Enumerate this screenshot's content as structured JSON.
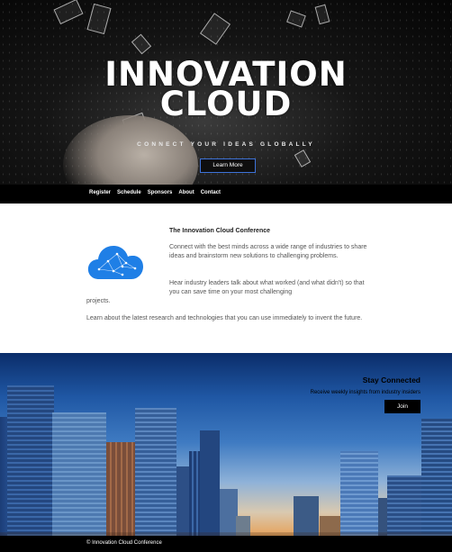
{
  "hero": {
    "title_line1": "INNOVATION",
    "title_line2": "CLOUD",
    "tagline": "CONNECT YOUR IDEAS GLOBALLY",
    "cta_label": "Learn More"
  },
  "nav": {
    "items": [
      "Register",
      "Schedule",
      "Sponsors",
      "About",
      "Contact"
    ]
  },
  "about": {
    "heading": "The Innovation Cloud Conference",
    "paragraph1": "Connect with the best minds across a wide range of industries to share ideas and brainstorm new solutions to challenging problems.",
    "paragraph2_part1": "Hear industry leaders talk about what worked (and what didn't) so that you can save time on your most challenging",
    "paragraph2_part2": "projects.",
    "paragraph3": "Learn about the latest research and technologies that you can use immediately to invent the future.",
    "icon": "cloud-network-icon"
  },
  "subscribe": {
    "title": "Stay Connected",
    "subtitle": "Receive weekly insights from industry insiders",
    "button_label": "Join"
  },
  "footer": {
    "text": "© Innovation Cloud Conference"
  },
  "colors": {
    "nav_background": "#000000",
    "cloud_blue": "#1f7fe6",
    "cta_border": "#3d72d8"
  }
}
